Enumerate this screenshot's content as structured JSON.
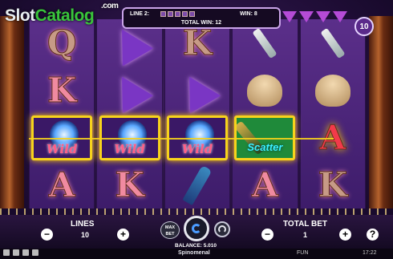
{
  "logo": {
    "slot": "Slot",
    "catalog": "Catalog",
    "dotcom": ".com"
  },
  "header": {
    "line_label": "LINE 2:",
    "win_label": "WIN: 8",
    "total_win": "TOTAL WIN: 12",
    "lines_badge": "10"
  },
  "reels": [
    [
      "Q",
      "K",
      "Wild",
      "A"
    ],
    [
      "party-hat",
      "party-hat",
      "Wild",
      "K"
    ],
    [
      "K",
      "party-hat",
      "Wild",
      "rocket"
    ],
    [
      "champagne-glass",
      "bird",
      "Scatter",
      "A"
    ],
    [
      "champagne-glass",
      "bird",
      "A",
      "K"
    ]
  ],
  "symbols": {
    "wild": "Wild",
    "scatter": "Scatter"
  },
  "controls": {
    "lines_label": "LINES",
    "lines_value": "10",
    "minus": "−",
    "plus": "+",
    "max_bet": "MAX BET",
    "balance": "BALANCE: 5.010",
    "total_bet_label": "TOTAL BET",
    "total_bet_value": "1",
    "help": "?"
  },
  "status": {
    "brand": "Spinomenal",
    "mode": "FUN",
    "time": "17:22"
  }
}
